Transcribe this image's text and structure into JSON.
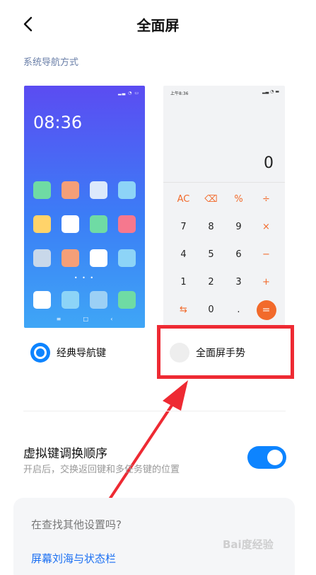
{
  "header": {
    "title": "全面屏"
  },
  "section": {
    "label": "系统导航方式"
  },
  "preview_left": {
    "clock": "08:36",
    "page_dots": "• • •",
    "nav_buttons": [
      "≡",
      "□",
      "‹"
    ],
    "app_colors": [
      "#6fdba4",
      "#f59f78",
      "#dce9fb",
      "#8dd4f7",
      "#ffd36a",
      "#ffffff",
      "#6fdba4",
      "#f6788e",
      "#c9d8ea",
      "#f59f78",
      "#ffffff",
      "#8dd4f7"
    ],
    "dock_colors": [
      "#ffffff",
      "#8dd4f7",
      "#9cd0f5",
      "#6fdba4"
    ]
  },
  "preview_right": {
    "status_time": "上午8:36",
    "display": "0",
    "keys": [
      {
        "label": "AC",
        "kind": "op"
      },
      {
        "label": "⌫",
        "kind": "op"
      },
      {
        "label": "%",
        "kind": "op"
      },
      {
        "label": "÷",
        "kind": "op"
      },
      {
        "label": "7",
        "kind": "num"
      },
      {
        "label": "8",
        "kind": "num"
      },
      {
        "label": "9",
        "kind": "num"
      },
      {
        "label": "×",
        "kind": "op"
      },
      {
        "label": "4",
        "kind": "num"
      },
      {
        "label": "5",
        "kind": "num"
      },
      {
        "label": "6",
        "kind": "num"
      },
      {
        "label": "−",
        "kind": "op"
      },
      {
        "label": "1",
        "kind": "num"
      },
      {
        "label": "2",
        "kind": "num"
      },
      {
        "label": "3",
        "kind": "num"
      },
      {
        "label": "+",
        "kind": "op"
      },
      {
        "label": "⇆",
        "kind": "op"
      },
      {
        "label": "0",
        "kind": "num"
      },
      {
        "label": ".",
        "kind": "num"
      },
      {
        "label": "=",
        "kind": "eq"
      }
    ]
  },
  "options": {
    "classic_label": "经典导航键",
    "gesture_label": "全面屏手势"
  },
  "setting": {
    "title": "虚拟键调换顺序",
    "subtitle": "开启后，交换返回键和多任务键的位置"
  },
  "card": {
    "question": "在查找其他设置吗?",
    "link": "屏幕刘海与状态栏"
  },
  "watermark": "Bai度经验",
  "colors": {
    "accent": "#0d84ff",
    "annotation": "#ee2a33",
    "calc_op": "#f26a2b"
  }
}
